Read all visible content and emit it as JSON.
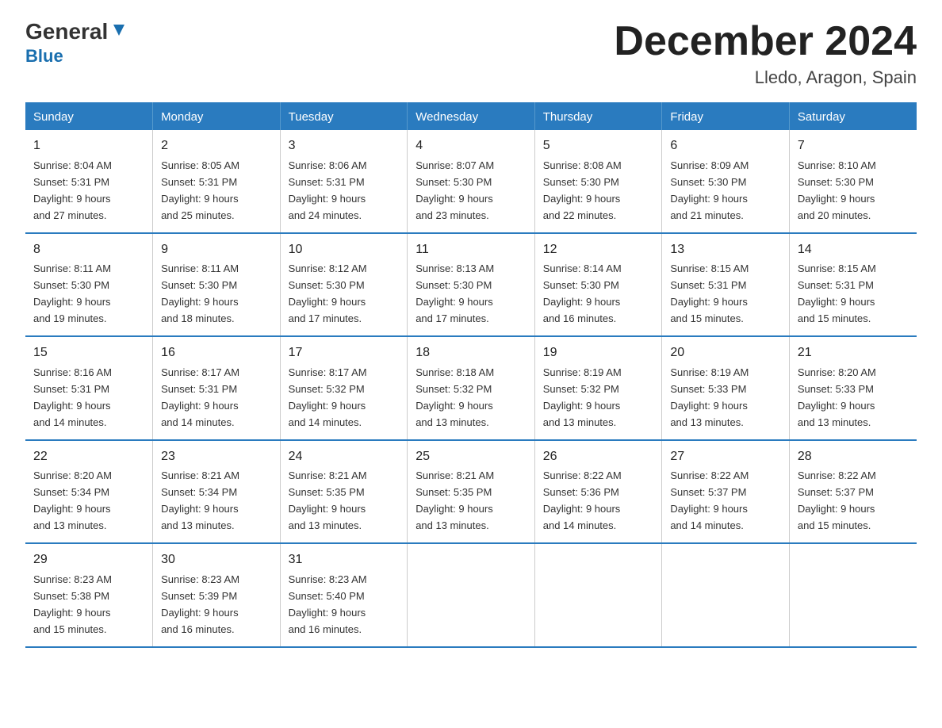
{
  "header": {
    "logo_general": "General",
    "logo_blue": "Blue",
    "main_title": "December 2024",
    "subtitle": "Lledo, Aragon, Spain"
  },
  "days_of_week": [
    "Sunday",
    "Monday",
    "Tuesday",
    "Wednesday",
    "Thursday",
    "Friday",
    "Saturday"
  ],
  "weeks": [
    [
      {
        "day": "1",
        "sunrise": "8:04 AM",
        "sunset": "5:31 PM",
        "daylight": "9 hours and 27 minutes."
      },
      {
        "day": "2",
        "sunrise": "8:05 AM",
        "sunset": "5:31 PM",
        "daylight": "9 hours and 25 minutes."
      },
      {
        "day": "3",
        "sunrise": "8:06 AM",
        "sunset": "5:31 PM",
        "daylight": "9 hours and 24 minutes."
      },
      {
        "day": "4",
        "sunrise": "8:07 AM",
        "sunset": "5:30 PM",
        "daylight": "9 hours and 23 minutes."
      },
      {
        "day": "5",
        "sunrise": "8:08 AM",
        "sunset": "5:30 PM",
        "daylight": "9 hours and 22 minutes."
      },
      {
        "day": "6",
        "sunrise": "8:09 AM",
        "sunset": "5:30 PM",
        "daylight": "9 hours and 21 minutes."
      },
      {
        "day": "7",
        "sunrise": "8:10 AM",
        "sunset": "5:30 PM",
        "daylight": "9 hours and 20 minutes."
      }
    ],
    [
      {
        "day": "8",
        "sunrise": "8:11 AM",
        "sunset": "5:30 PM",
        "daylight": "9 hours and 19 minutes."
      },
      {
        "day": "9",
        "sunrise": "8:11 AM",
        "sunset": "5:30 PM",
        "daylight": "9 hours and 18 minutes."
      },
      {
        "day": "10",
        "sunrise": "8:12 AM",
        "sunset": "5:30 PM",
        "daylight": "9 hours and 17 minutes."
      },
      {
        "day": "11",
        "sunrise": "8:13 AM",
        "sunset": "5:30 PM",
        "daylight": "9 hours and 17 minutes."
      },
      {
        "day": "12",
        "sunrise": "8:14 AM",
        "sunset": "5:30 PM",
        "daylight": "9 hours and 16 minutes."
      },
      {
        "day": "13",
        "sunrise": "8:15 AM",
        "sunset": "5:31 PM",
        "daylight": "9 hours and 15 minutes."
      },
      {
        "day": "14",
        "sunrise": "8:15 AM",
        "sunset": "5:31 PM",
        "daylight": "9 hours and 15 minutes."
      }
    ],
    [
      {
        "day": "15",
        "sunrise": "8:16 AM",
        "sunset": "5:31 PM",
        "daylight": "9 hours and 14 minutes."
      },
      {
        "day": "16",
        "sunrise": "8:17 AM",
        "sunset": "5:31 PM",
        "daylight": "9 hours and 14 minutes."
      },
      {
        "day": "17",
        "sunrise": "8:17 AM",
        "sunset": "5:32 PM",
        "daylight": "9 hours and 14 minutes."
      },
      {
        "day": "18",
        "sunrise": "8:18 AM",
        "sunset": "5:32 PM",
        "daylight": "9 hours and 13 minutes."
      },
      {
        "day": "19",
        "sunrise": "8:19 AM",
        "sunset": "5:32 PM",
        "daylight": "9 hours and 13 minutes."
      },
      {
        "day": "20",
        "sunrise": "8:19 AM",
        "sunset": "5:33 PM",
        "daylight": "9 hours and 13 minutes."
      },
      {
        "day": "21",
        "sunrise": "8:20 AM",
        "sunset": "5:33 PM",
        "daylight": "9 hours and 13 minutes."
      }
    ],
    [
      {
        "day": "22",
        "sunrise": "8:20 AM",
        "sunset": "5:34 PM",
        "daylight": "9 hours and 13 minutes."
      },
      {
        "day": "23",
        "sunrise": "8:21 AM",
        "sunset": "5:34 PM",
        "daylight": "9 hours and 13 minutes."
      },
      {
        "day": "24",
        "sunrise": "8:21 AM",
        "sunset": "5:35 PM",
        "daylight": "9 hours and 13 minutes."
      },
      {
        "day": "25",
        "sunrise": "8:21 AM",
        "sunset": "5:35 PM",
        "daylight": "9 hours and 13 minutes."
      },
      {
        "day": "26",
        "sunrise": "8:22 AM",
        "sunset": "5:36 PM",
        "daylight": "9 hours and 14 minutes."
      },
      {
        "day": "27",
        "sunrise": "8:22 AM",
        "sunset": "5:37 PM",
        "daylight": "9 hours and 14 minutes."
      },
      {
        "day": "28",
        "sunrise": "8:22 AM",
        "sunset": "5:37 PM",
        "daylight": "9 hours and 15 minutes."
      }
    ],
    [
      {
        "day": "29",
        "sunrise": "8:23 AM",
        "sunset": "5:38 PM",
        "daylight": "9 hours and 15 minutes."
      },
      {
        "day": "30",
        "sunrise": "8:23 AM",
        "sunset": "5:39 PM",
        "daylight": "9 hours and 16 minutes."
      },
      {
        "day": "31",
        "sunrise": "8:23 AM",
        "sunset": "5:40 PM",
        "daylight": "9 hours and 16 minutes."
      },
      null,
      null,
      null,
      null
    ]
  ],
  "labels": {
    "sunrise_prefix": "Sunrise: ",
    "sunset_prefix": "Sunset: ",
    "daylight_prefix": "Daylight: "
  }
}
